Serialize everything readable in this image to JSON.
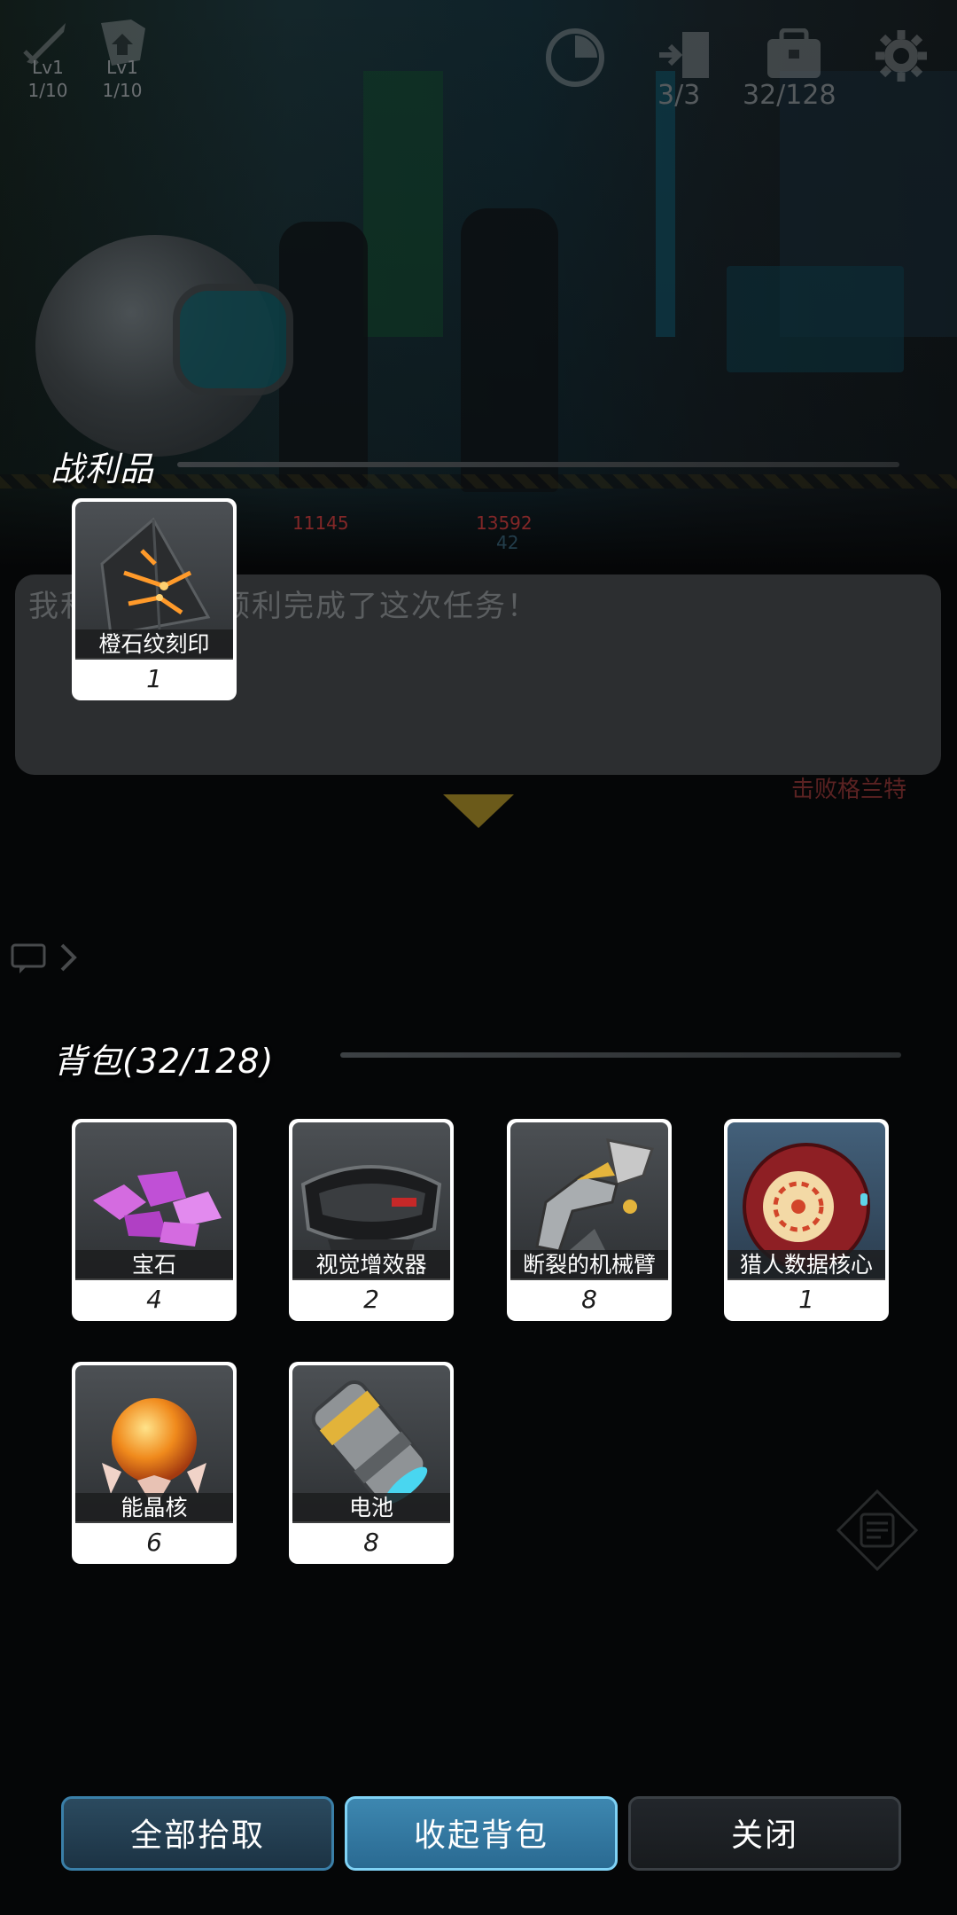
{
  "hud": {
    "skill1": {
      "level": "Lv1",
      "progress": "1/10"
    },
    "skill2": {
      "level": "Lv1",
      "progress": "1/10"
    },
    "door_count": "3/3",
    "bag_count": "32/128"
  },
  "scene": {
    "hp_left": "11145",
    "hp_right": "13592",
    "hp_right_sub": "42"
  },
  "loot": {
    "title": "战利品",
    "items": [
      {
        "name": "橙石纹刻印",
        "qty": "1"
      }
    ]
  },
  "dialog": {
    "text": "我和　　　　顺利完成了这次任务！",
    "caption": "击败格兰特"
  },
  "backpack": {
    "title": "背包(32/128)",
    "items": [
      {
        "name": "宝石",
        "qty": "4"
      },
      {
        "name": "视觉增效器",
        "qty": "2"
      },
      {
        "name": "断裂的机械臂",
        "qty": "8"
      },
      {
        "name": "猎人数据核心",
        "qty": "1"
      },
      {
        "name": "能晶核",
        "qty": "6"
      },
      {
        "name": "电池",
        "qty": "8"
      }
    ]
  },
  "buttons": {
    "pick_all": "全部拾取",
    "collapse": "收起背包",
    "close": "关闭"
  }
}
